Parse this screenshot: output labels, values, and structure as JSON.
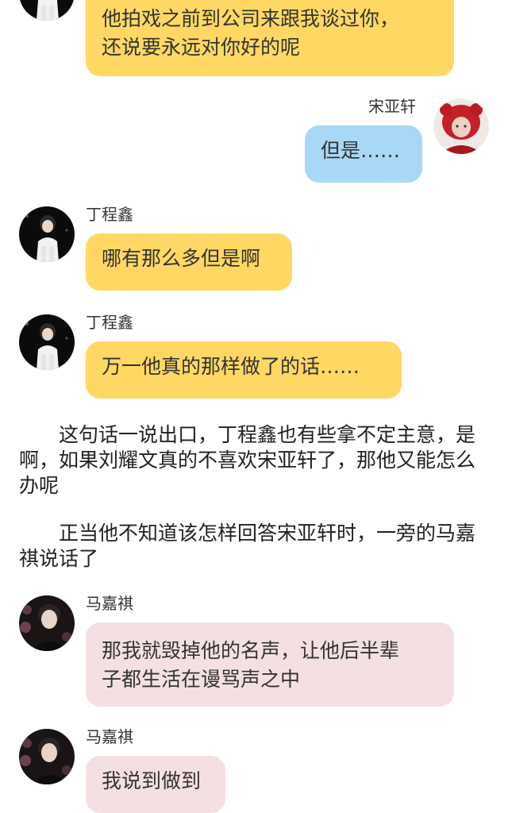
{
  "messages": [
    {
      "id": "m1",
      "side": "left",
      "sender": "",
      "avatar": "dingchengxin-avatar",
      "color": "yellow",
      "text": "他拍戏之前到公司来跟我谈过你，\n还说要永远对你好的呢"
    },
    {
      "id": "m2",
      "side": "right",
      "sender": "宋亚轩",
      "avatar": "songyaxuan-avatar",
      "color": "blue",
      "text": "但是……"
    },
    {
      "id": "m3",
      "side": "left",
      "sender": "丁程鑫",
      "avatar": "dingchengxin-avatar",
      "color": "yellow",
      "text": "哪有那么多但是啊"
    },
    {
      "id": "m4",
      "side": "left",
      "sender": "丁程鑫",
      "avatar": "dingchengxin-avatar",
      "color": "yellow",
      "text": "万一他真的那样做了的话……"
    },
    {
      "id": "m5",
      "side": "left",
      "sender": "马嘉祺",
      "avatar": "majiaqi-avatar",
      "color": "pink",
      "text": "那我就毁掉他的名声，让他后半辈\n子都生活在谩骂声之中"
    },
    {
      "id": "m6",
      "side": "left",
      "sender": "马嘉祺",
      "avatar": "majiaqi-avatar",
      "color": "pink",
      "text": "我说到做到"
    }
  ],
  "narration": [
    "　　这句话一说出口，丁程鑫也有些拿不定主意，是啊，如果刘耀文真的不喜欢宋亚轩了，那他又能怎么办呢",
    "　　正当他不知道该怎样回答宋亚轩时，一旁的马嘉祺说话了"
  ],
  "colors": {
    "bubble_yellow": "#ffd863",
    "bubble_blue": "#a8d8f5",
    "bubble_pink": "#f4e0e2"
  }
}
